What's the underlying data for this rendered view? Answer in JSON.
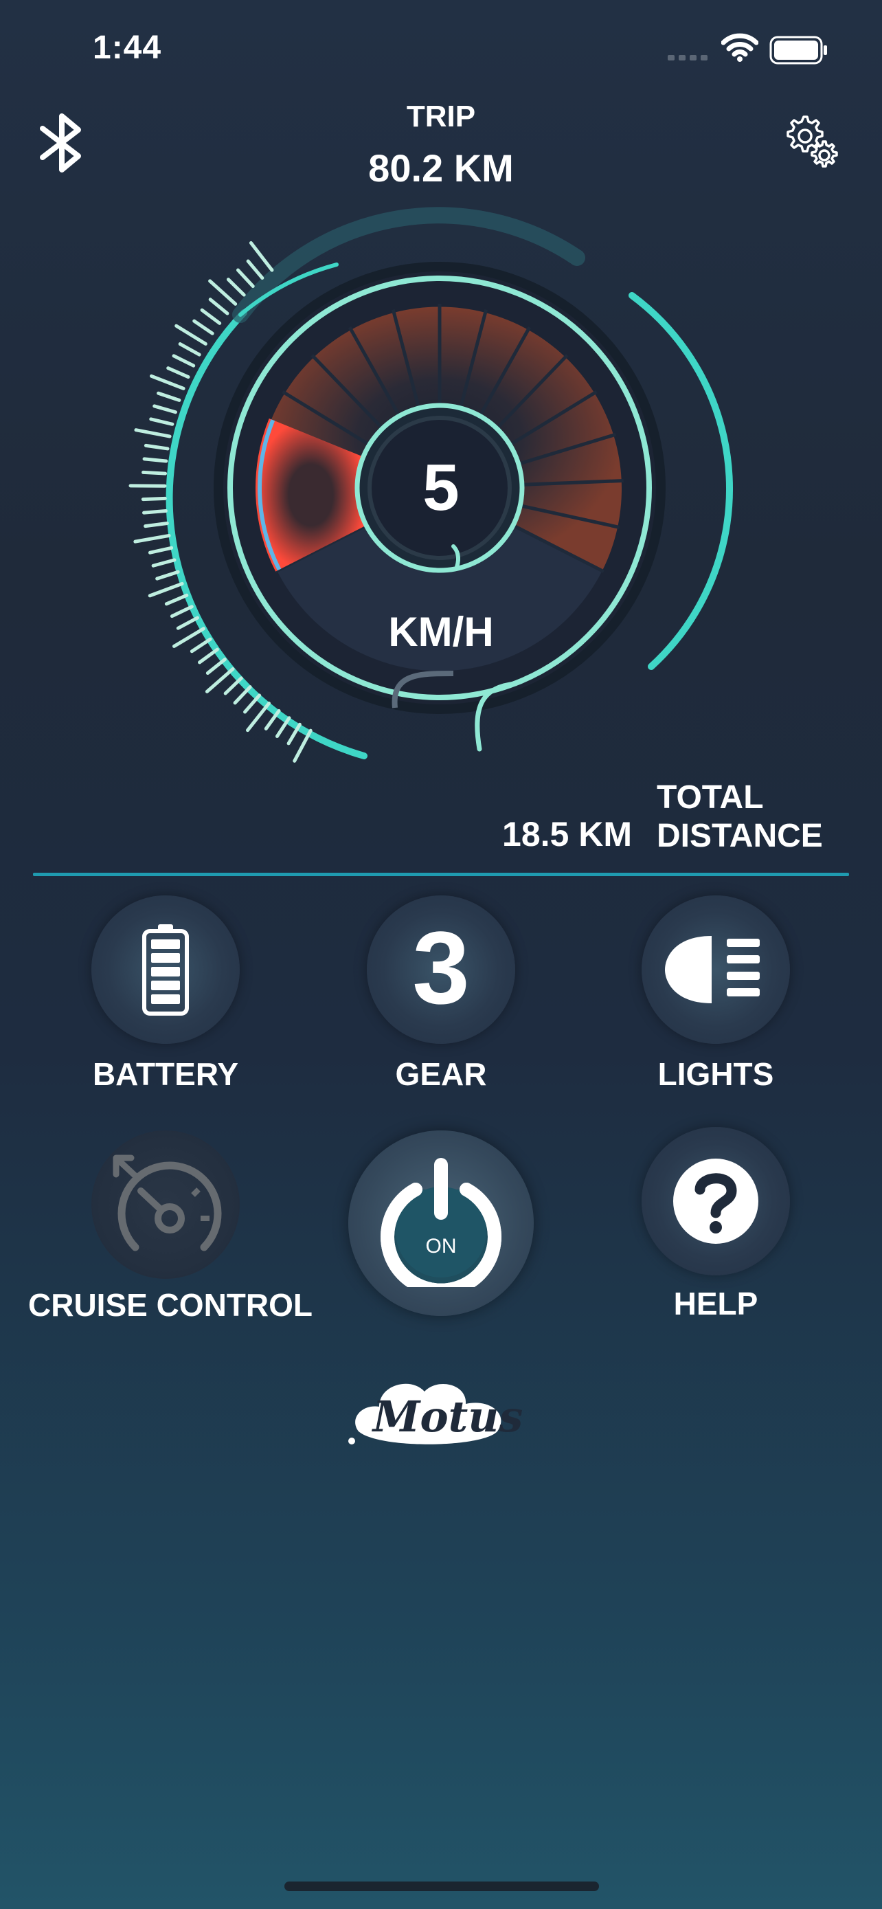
{
  "status_bar": {
    "time": "1:44"
  },
  "header": {
    "trip_label": "TRIP",
    "trip_value": "80.2 KM"
  },
  "speedometer": {
    "speed": "5",
    "unit": "KM/H",
    "speed_fraction": 0.1
  },
  "total_distance": {
    "value": "18.5 KM",
    "label_line1": "TOTAL",
    "label_line2": "DISTANCE"
  },
  "controls": {
    "battery_label": "BATTERY",
    "gear_label": "GEAR",
    "gear_value": "3",
    "lights_label": "LIGHTS",
    "cruise_label": "CRUISE CONTROL",
    "power_state": "ON",
    "help_label": "HELP"
  },
  "brand": {
    "logo_text": "Motus"
  },
  "colors": {
    "accent_teal": "#3fd6c6",
    "divider": "#1f9bb0",
    "speed_red": "#e53b35",
    "dial_brown": "#7a3c2e"
  }
}
